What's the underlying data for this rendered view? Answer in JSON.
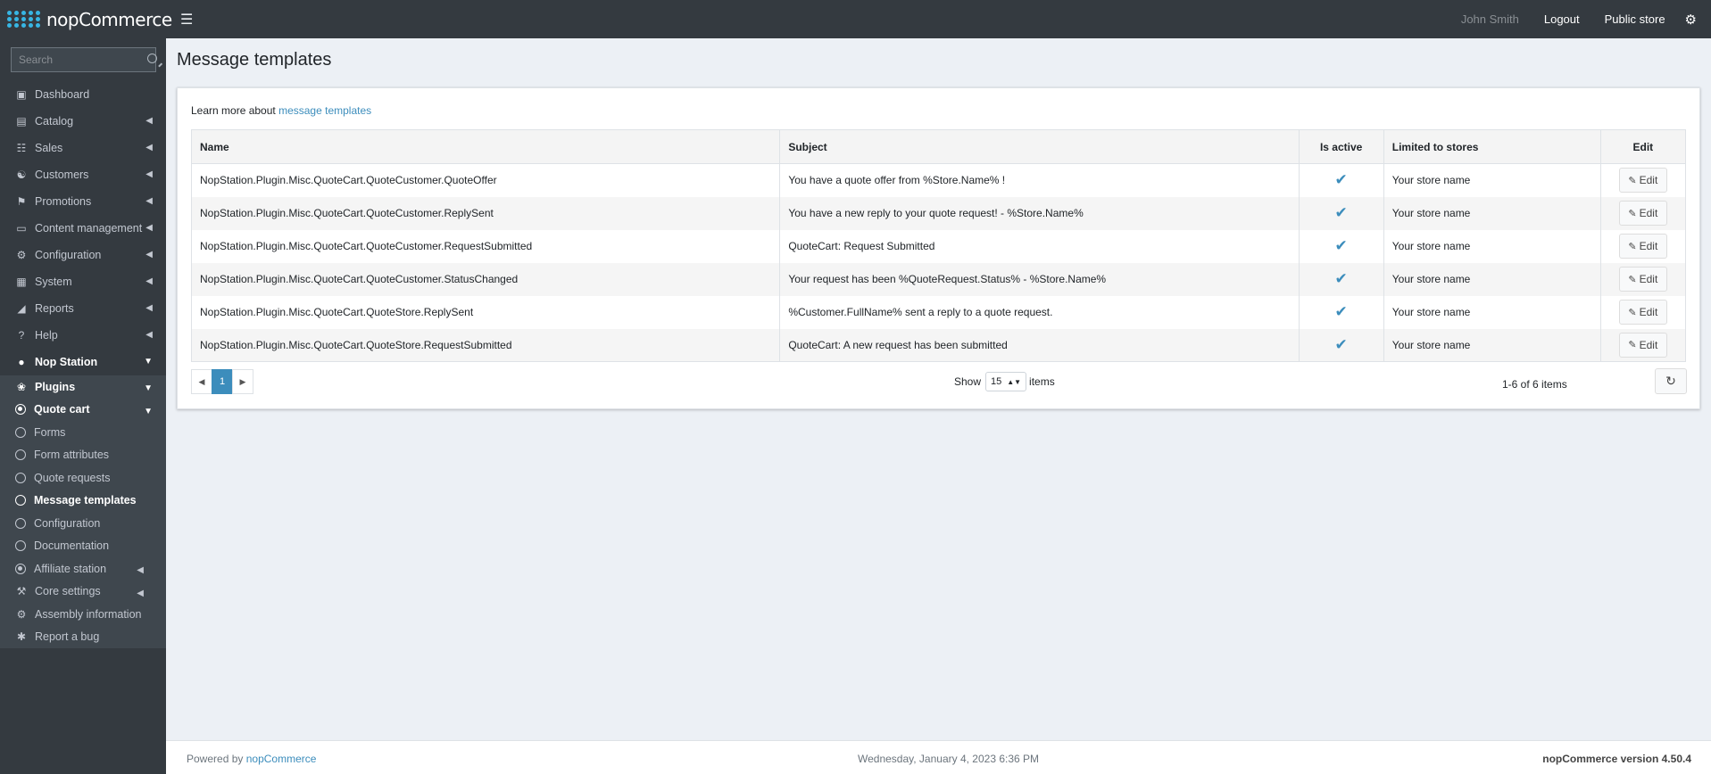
{
  "header": {
    "logo_text": "nopCommerce",
    "user_name": "John Smith",
    "logout_label": "Logout",
    "public_store_label": "Public store"
  },
  "sidebar": {
    "search_placeholder": "Search",
    "items": [
      {
        "label": "Dashboard",
        "icon": "monitor-icon"
      },
      {
        "label": "Catalog",
        "icon": "book-icon"
      },
      {
        "label": "Sales",
        "icon": "cart-icon"
      },
      {
        "label": "Customers",
        "icon": "user-icon"
      },
      {
        "label": "Promotions",
        "icon": "tags-icon"
      },
      {
        "label": "Content management",
        "icon": "desktop-icon"
      },
      {
        "label": "Configuration",
        "icon": "gears-icon"
      },
      {
        "label": "System",
        "icon": "cube-icon"
      },
      {
        "label": "Reports",
        "icon": "chart-icon"
      },
      {
        "label": "Help",
        "icon": "question-icon"
      },
      {
        "label": "Nop Station",
        "icon": "circle-icon"
      }
    ],
    "plugins_label": "Plugins",
    "quote_cart_label": "Quote cart",
    "quote_cart_items": [
      "Forms",
      "Form attributes",
      "Quote requests",
      "Message templates",
      "Configuration",
      "Documentation"
    ],
    "affiliate_label": "Affiliate station",
    "core_settings_label": "Core settings",
    "assembly_label": "Assembly information",
    "report_bug_label": "Report a bug"
  },
  "main": {
    "title": "Message templates",
    "learn_prefix": "Learn more about",
    "learn_link": "message templates",
    "columns": {
      "name": "Name",
      "subject": "Subject",
      "active": "Is active",
      "stores": "Limited to stores",
      "edit": "Edit"
    },
    "rows": [
      {
        "name": "NopStation.Plugin.Misc.QuoteCart.QuoteCustomer.QuoteOffer",
        "subject": "You have a quote offer from %Store.Name% !",
        "stores": "Your store name"
      },
      {
        "name": "NopStation.Plugin.Misc.QuoteCart.QuoteCustomer.ReplySent",
        "subject": "You have a new reply to your quote request! - %Store.Name%",
        "stores": "Your store name"
      },
      {
        "name": "NopStation.Plugin.Misc.QuoteCart.QuoteCustomer.RequestSubmitted",
        "subject": "QuoteCart: Request Submitted",
        "stores": "Your store name"
      },
      {
        "name": "NopStation.Plugin.Misc.QuoteCart.QuoteCustomer.StatusChanged",
        "subject": "Your request has been %QuoteRequest.Status% - %Store.Name%",
        "stores": "Your store name"
      },
      {
        "name": "NopStation.Plugin.Misc.QuoteCart.QuoteStore.ReplySent",
        "subject": "%Customer.FullName% sent a reply to a quote request.",
        "stores": "Your store name"
      },
      {
        "name": "NopStation.Plugin.Misc.QuoteCart.QuoteStore.RequestSubmitted",
        "subject": "QuoteCart: A new request has been submitted",
        "stores": "Your store name"
      }
    ],
    "edit_label": "Edit",
    "pager": {
      "current": "1",
      "show_label": "Show",
      "page_size": "15",
      "items_label": "items",
      "info": "1-6 of 6 items"
    }
  },
  "footer": {
    "powered_prefix": "Powered by",
    "powered_link": "nopCommerce",
    "datetime": "Wednesday, January 4, 2023 6:36 PM",
    "version": "nopCommerce version 4.50.4"
  },
  "colors": {
    "accent": "#3c8dbc",
    "sidebar_bg": "#343a40",
    "page_bg": "#ecf0f5"
  }
}
